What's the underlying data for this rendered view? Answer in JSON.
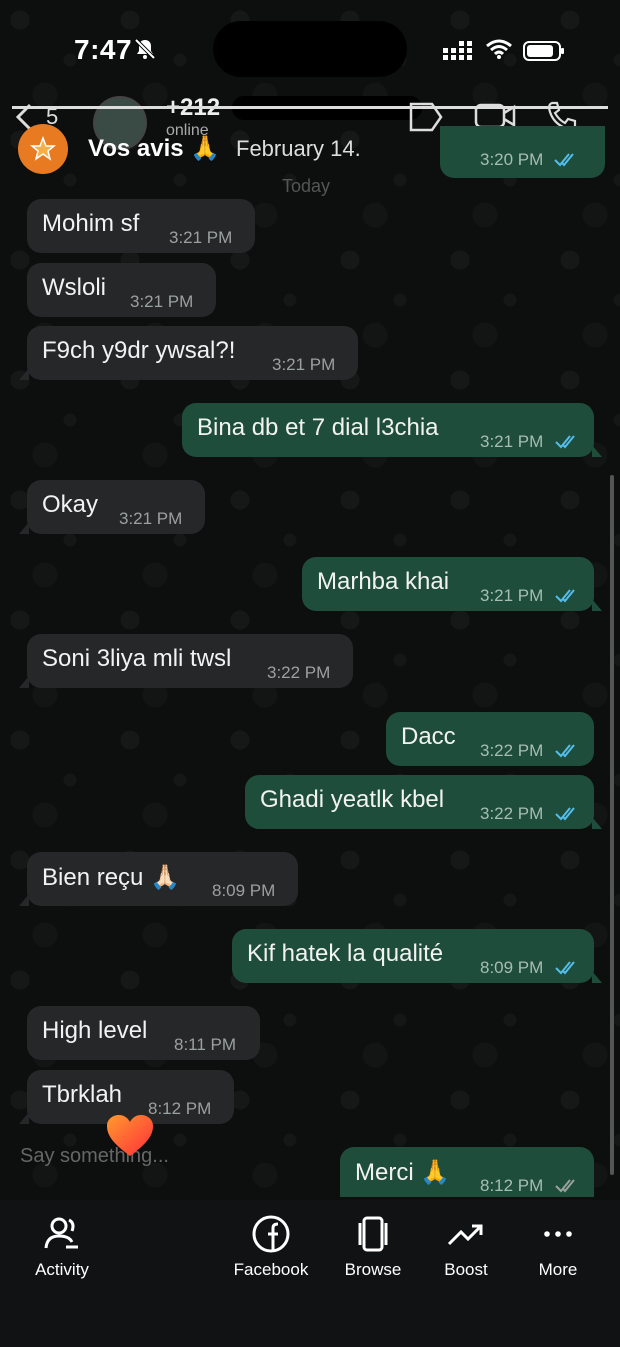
{
  "status_bar": {
    "time": "7:47"
  },
  "wa_header": {
    "back_count": "5",
    "contact_name": "+212",
    "contact_status": "online"
  },
  "overlay": {
    "title": "Vos avis 🙏",
    "date": "February 14.",
    "day_separator": "Today"
  },
  "messages": [
    {
      "dir": "in",
      "text": "Mohim sf",
      "time": "3:21 PM"
    },
    {
      "dir": "in",
      "text": "Wsloli",
      "time": "3:21 PM"
    },
    {
      "dir": "in",
      "text": "F9ch y9dr ywsal?!",
      "time": "3:21 PM"
    },
    {
      "dir": "out",
      "text": "Bina db et 7 dial l3chia",
      "time": "3:21 PM"
    },
    {
      "dir": "in",
      "text": "Okay",
      "time": "3:21 PM"
    },
    {
      "dir": "out",
      "text": "Marhba khai",
      "time": "3:21 PM"
    },
    {
      "dir": "in",
      "text": "Soni 3liya mli twsl",
      "time": "3:22 PM"
    },
    {
      "dir": "out",
      "text": "Dacc",
      "time": "3:22 PM"
    },
    {
      "dir": "out",
      "text": "Ghadi yeatlk kbel",
      "time": "3:22 PM"
    },
    {
      "dir": "in",
      "text": "Bien reçu 🙏🏻",
      "time": "8:09 PM"
    },
    {
      "dir": "out",
      "text": "Kif hatek la qualité",
      "time": "8:09 PM"
    },
    {
      "dir": "in",
      "text": "High level",
      "time": "8:11 PM"
    },
    {
      "dir": "in",
      "text": "Tbrklah",
      "time": "8:12 PM"
    },
    {
      "dir": "out",
      "text": "Merci 🙏",
      "time": "8:12 PM"
    }
  ],
  "top_partial_time": "3:20 PM",
  "reply_placeholder": "Say something...",
  "bottom_nav": {
    "activity": "Activity",
    "facebook": "Facebook",
    "browse": "Browse",
    "boost": "Boost",
    "more": "More"
  },
  "colors": {
    "incoming_bubble": "#262729",
    "outgoing_bubble": "#1e4d3c",
    "tick_read": "#53bdeb",
    "accent": "#e87a22"
  }
}
